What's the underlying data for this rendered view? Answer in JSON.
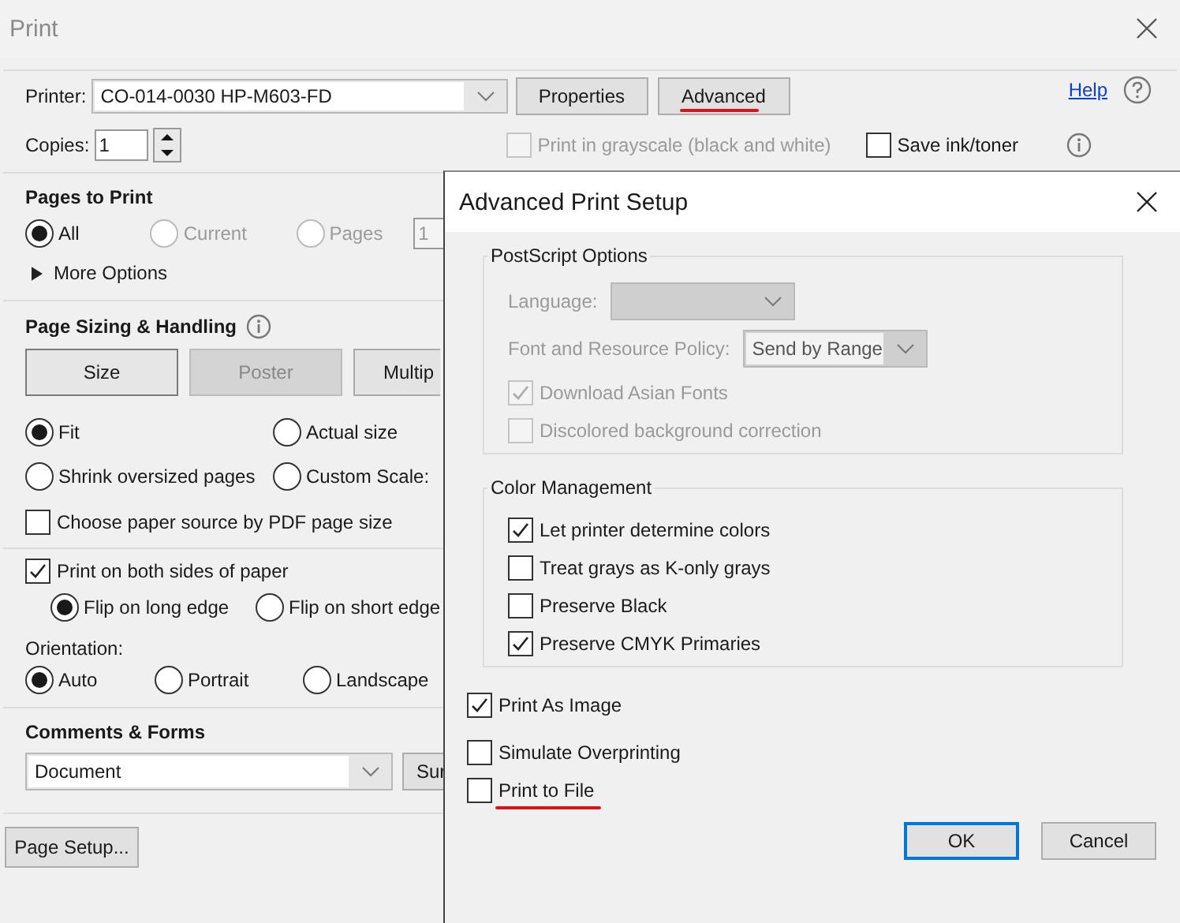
{
  "window": {
    "title": "Print"
  },
  "printer": {
    "label": "Printer:",
    "value": "CO-014-0030 HP-M603-FD"
  },
  "top_buttons": [
    {
      "label": "Properties",
      "annotated": false
    },
    {
      "label": "Advanced",
      "annotated": true
    }
  ],
  "help": {
    "label": "Help"
  },
  "copies": {
    "label": "Copies:",
    "value": "1"
  },
  "print_options": [
    {
      "label": "Print in grayscale (black and white)",
      "checked": false,
      "disabled": true
    },
    {
      "label": "Save ink/toner",
      "checked": false,
      "disabled": false
    }
  ],
  "pages_to_print": {
    "title": "Pages to Print",
    "options": [
      {
        "label": "All",
        "selected": true,
        "disabled": false
      },
      {
        "label": "Current",
        "selected": false,
        "disabled": true
      },
      {
        "label": "Pages",
        "selected": false,
        "disabled": true
      }
    ],
    "pages_value": "1",
    "more_options": "More Options"
  },
  "page_sizing": {
    "title": "Page Sizing & Handling",
    "tabs": [
      {
        "label": "Size",
        "selected": true,
        "disabled": false
      },
      {
        "label": "Poster",
        "selected": false,
        "disabled": true
      },
      {
        "label": "Multip",
        "selected": false,
        "disabled": false
      }
    ],
    "options": [
      {
        "label": "Fit",
        "selected": true
      },
      {
        "label": "Actual size",
        "selected": false
      },
      {
        "label": "Shrink oversized pages",
        "selected": false
      },
      {
        "label": "Custom Scale:",
        "selected": false
      }
    ],
    "paper_source": {
      "label": "Choose paper source by PDF page size",
      "checked": false
    }
  },
  "duplex": {
    "label": "Print on both sides of paper",
    "checked": true,
    "options": [
      {
        "label": "Flip on long edge",
        "selected": true
      },
      {
        "label": "Flip on short edge",
        "selected": false
      }
    ]
  },
  "orientation": {
    "label": "Orientation:",
    "options": [
      {
        "label": "Auto",
        "selected": true
      },
      {
        "label": "Portrait",
        "selected": false
      },
      {
        "label": "Landscape",
        "selected": false
      }
    ]
  },
  "comments": {
    "title": "Comments & Forms",
    "value": "Document",
    "button": "Sur"
  },
  "page_setup": "Page Setup...",
  "advanced": {
    "title": "Advanced Print Setup",
    "postscript": {
      "title": "PostScript Options",
      "language_label": "Language:",
      "policy_label": "Font and Resource Policy:",
      "policy_value": "Send by Range",
      "checks": [
        {
          "label": "Download Asian Fonts",
          "checked": true,
          "disabled": true
        },
        {
          "label": "Discolored background correction",
          "checked": false,
          "disabled": true
        }
      ]
    },
    "color": {
      "title": "Color Management",
      "checks": [
        {
          "label": "Let printer determine colors",
          "checked": true
        },
        {
          "label": "Treat grays as K-only grays",
          "checked": false
        },
        {
          "label": "Preserve Black",
          "checked": false
        },
        {
          "label": "Preserve CMYK Primaries",
          "checked": true
        }
      ]
    },
    "checks": [
      {
        "label": "Print As Image",
        "checked": true,
        "annotated": false
      },
      {
        "label": "Simulate Overprinting",
        "checked": false,
        "annotated": false
      },
      {
        "label": "Print to File",
        "checked": false,
        "annotated": true
      }
    ],
    "buttons": [
      {
        "label": "OK",
        "default": true
      },
      {
        "label": "Cancel",
        "default": false
      }
    ]
  }
}
